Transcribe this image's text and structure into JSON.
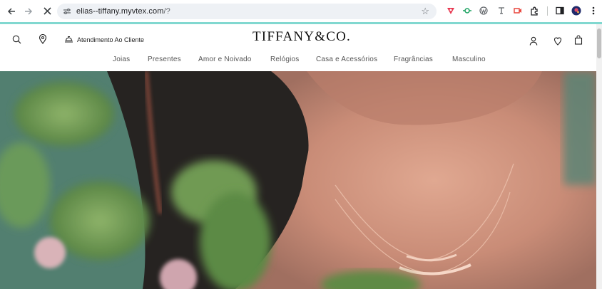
{
  "browser": {
    "url_host": "elias--tiffany.myvtex.com",
    "url_path": "/?"
  },
  "header": {
    "logo": "TIFFANY&CO.",
    "customer_service": "Atendimento Ao Cliente"
  },
  "menu": {
    "items": [
      "Joias",
      "Presentes",
      "Amor e Noivado",
      "Relógios",
      "Casa e Acessórios",
      "Fragrâncias",
      "Masculino"
    ]
  },
  "colors": {
    "brand_teal": "#81d8d0"
  }
}
